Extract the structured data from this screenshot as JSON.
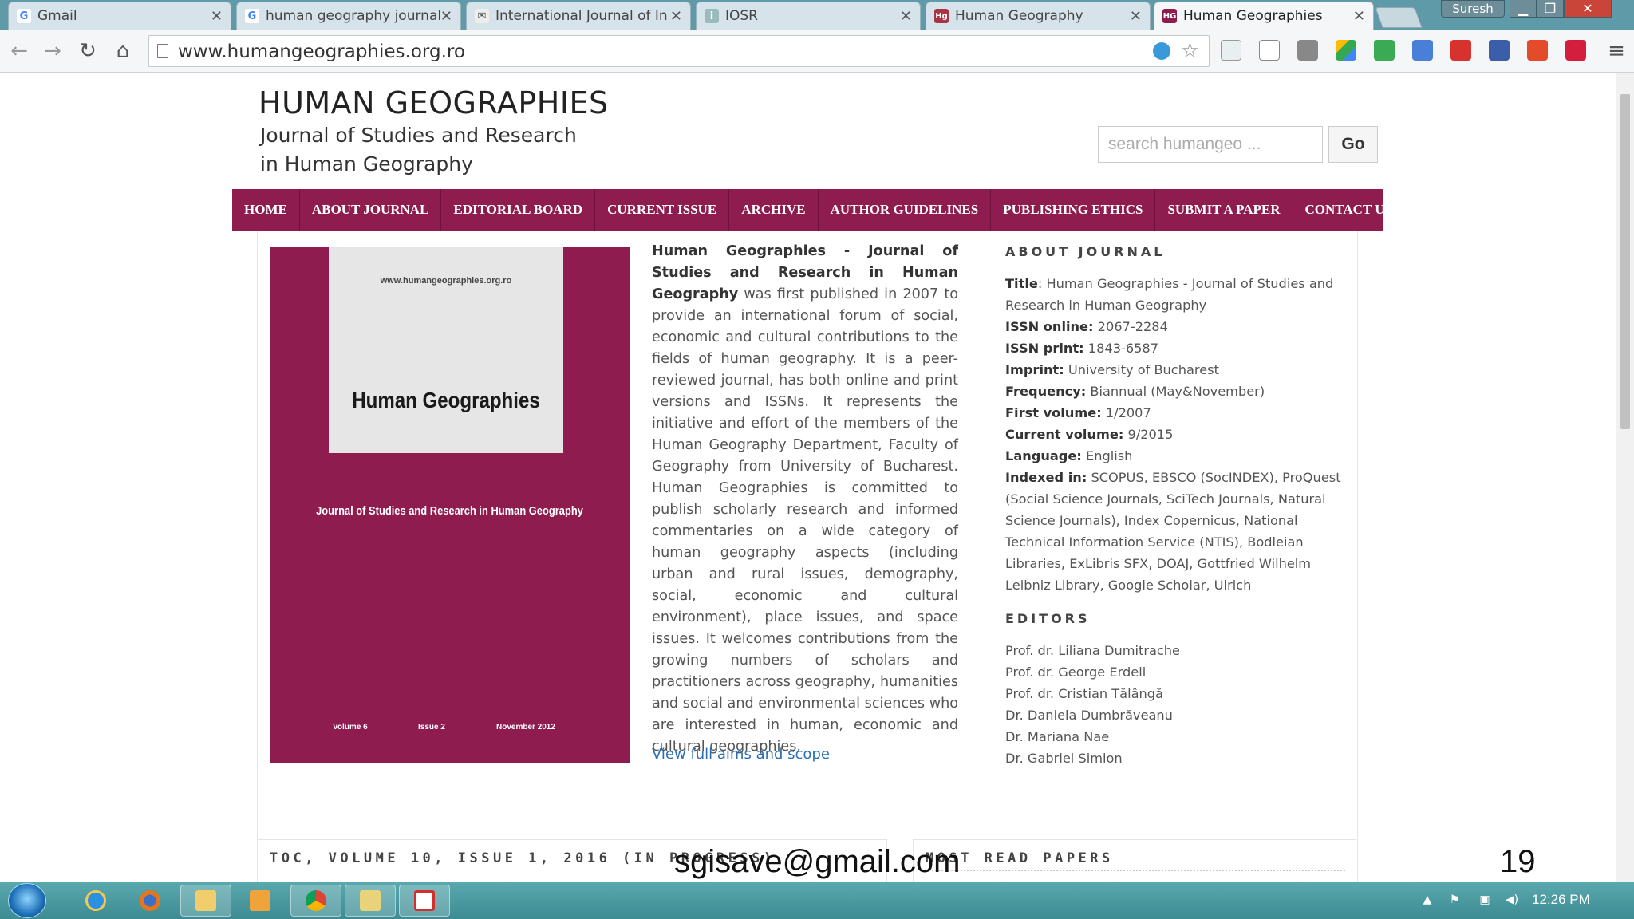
{
  "browser": {
    "tabs": [
      {
        "title": "Gmail",
        "favicon": "G",
        "active": false
      },
      {
        "title": "human geography journal",
        "favicon": "G",
        "active": false
      },
      {
        "title": "International Journal of In",
        "favicon": "✉",
        "active": false
      },
      {
        "title": "IOSR",
        "favicon": "i",
        "active": false
      },
      {
        "title": "Human Geography",
        "favicon": "Hg",
        "active": false
      },
      {
        "title": "Human Geographies",
        "favicon": "HG",
        "active": true
      }
    ],
    "user": "Suresh",
    "url": "www.humangeographies.org.ro",
    "close_glyph": "✕"
  },
  "site": {
    "title": "HUMAN GEOGRAPHIES",
    "subtitle_line1": "Journal of Studies and Research",
    "subtitle_line2": "in Human Geography",
    "search_placeholder": "search humangeo ...",
    "go_label": "Go",
    "nav": [
      "HOME",
      "ABOUT JOURNAL",
      "EDITORIAL BOARD",
      "CURRENT ISSUE",
      "ARCHIVE",
      "AUTHOR GUIDELINES",
      "PUBLISHING ETHICS",
      "SUBMIT A PAPER",
      "CONTACT US"
    ]
  },
  "cover": {
    "url": "www.humangeographies.org.ro",
    "title": "Human Geographies",
    "subtitle": "Journal of Studies and Research in Human Geography",
    "volume": "Volume 6",
    "issue": "Issue 2",
    "date": "November 2012"
  },
  "description": {
    "bold": "Human Geographies - Journal of Studies and Research in Human Geography",
    "text": " was first published in 2007 to provide an international forum of social, economic and cultural contributions to the fields of human geography. It is a peer-reviewed journal, has both online and print versions and ISSNs. It represents the initiative and effort of the members of the Human Geography Department, Faculty of Geography from University of Bucharest. Human Geographies is committed to publish scholarly research and informed commentaries on a wide category of human geography aspects (including urban and rural issues, demography, social, economic and cultural environment), place issues, and space issues. It welcomes contributions from the growing numbers of scholars and practitioners across geography, humanities and social and environmental sciences who are interested in human, economic and cultural geographies.",
    "link": "View full aims and scope"
  },
  "about": {
    "heading": "ABOUT JOURNAL",
    "fields": [
      {
        "label": "Title",
        "value": ": Human Geographies - Journal of Studies and Research in Human Geography"
      },
      {
        "label": "ISSN online:",
        "value": " 2067-2284"
      },
      {
        "label": "ISSN print:",
        "value": " 1843-6587"
      },
      {
        "label": "Imprint:",
        "value": " University of Bucharest"
      },
      {
        "label": "Frequency:",
        "value": " Biannual (May&November)"
      },
      {
        "label": "First volume:",
        "value": " 1/2007"
      },
      {
        "label": "Current volume:",
        "value": " 9/2015"
      },
      {
        "label": "Language:",
        "value": " English"
      },
      {
        "label": "Indexed in:",
        "value": " SCOPUS, EBSCO (SocINDEX), ProQuest (Social Science Journals, SciTech Journals, Natural Science Journals), Index Copernicus, National Technical Information Service (NTIS), Bodleian Libraries, ExLibris SFX, DOAJ, Gottfried Wilhelm Leibniz Library, Google Scholar, Ulrich"
      }
    ]
  },
  "editors": {
    "heading": "EDITORS",
    "names": [
      "Prof. dr. Liliana Dumitrache",
      "Prof. dr. George Erdeli",
      "Prof. dr. Cristian Tălângă",
      "Dr. Daniela Dumbrăveanu",
      "Dr. Mariana Nae",
      "Dr. Gabriel Simion"
    ]
  },
  "bottom": {
    "toc_heading": "TOC, VOLUME 10, ISSUE 1, 2016 (IN PROGRESS)",
    "most_read_heading": "MOST READ PAPERS"
  },
  "overlay": {
    "email": "sgisave@gmail.com",
    "slide_number": "19"
  },
  "taskbar": {
    "clock": "12:26 PM"
  },
  "colors": {
    "brand": "#8f1c4f",
    "link": "#2a6fb5"
  }
}
